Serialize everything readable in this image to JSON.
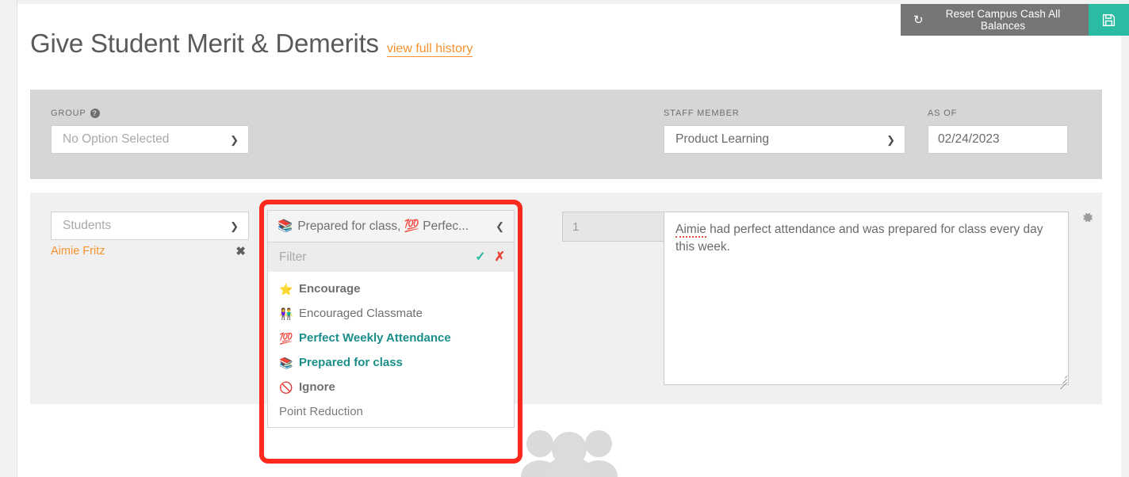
{
  "header": {
    "title": "Give Student Merit & Demerits",
    "history_link": "view full history",
    "reset_button": "Reset Campus Cash All Balances",
    "reset_icon": "undo-icon",
    "save_icon": "floppy-disk-icon"
  },
  "filters": {
    "group": {
      "label": "GROUP",
      "help_icon": "question-mark-icon",
      "value": "No Option Selected"
    },
    "staff_member": {
      "label": "STAFF MEMBER",
      "value": "Product Learning"
    },
    "as_of": {
      "label": "AS OF",
      "value": "02/24/2023"
    }
  },
  "entry_row": {
    "students": {
      "placeholder": "Students",
      "chips": [
        {
          "name": "Aimie Fritz",
          "remove_icon": "close-icon"
        }
      ]
    },
    "points": {
      "value": "1"
    },
    "note": {
      "text_part_1": "Aimie",
      "text_part_2": " had perfect attendance and was prepared for class every day this week."
    },
    "gear_icon": "gear-icon"
  },
  "behaviour_dropdown": {
    "selected_summary": "Prepared for class, 💯 Perfec...",
    "summary_emoji": "📚",
    "collapse_icon": "chevron-up-icon",
    "filter_placeholder": "Filter",
    "confirm_icon": "check-icon",
    "clear_icon": "close-icon",
    "options": [
      {
        "emoji": "⭐",
        "label": "Encourage",
        "style": "header-opt"
      },
      {
        "emoji": "👫",
        "label": "Encouraged Classmate",
        "style": "plain"
      },
      {
        "emoji": "💯",
        "label": "Perfect Weekly Attendance",
        "style": "selected"
      },
      {
        "emoji": "📚",
        "label": "Prepared for class",
        "style": "selected"
      },
      {
        "emoji": "🚫",
        "label": "Ignore",
        "style": "header-opt"
      },
      {
        "emoji": "",
        "label": "Point Reduction",
        "style": "group-label"
      }
    ]
  },
  "colors": {
    "accent_orange": "#f5922f",
    "teal": "#2bbba3",
    "selected_teal": "#1a8f8a",
    "annotation_red": "#fb2a1c",
    "gray_button": "#767676"
  }
}
